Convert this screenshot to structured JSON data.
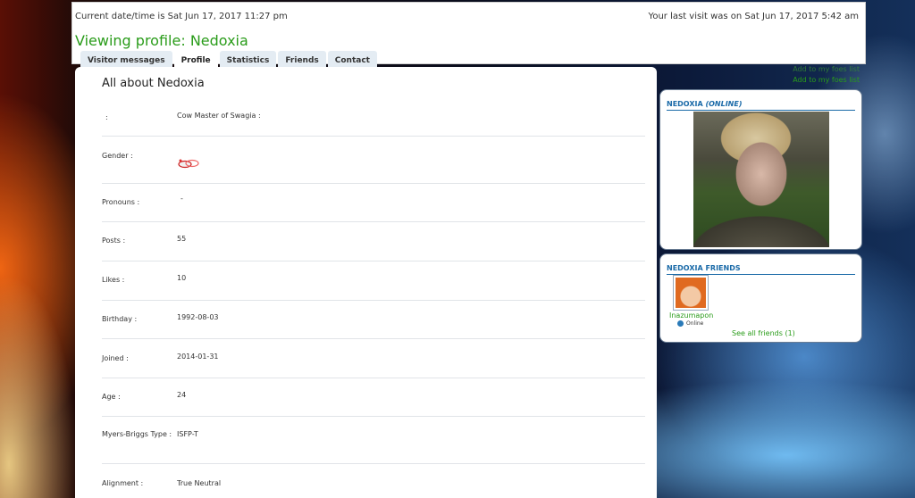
{
  "header": {
    "datetime": "Current date/time is Sat Jun 17, 2017 11:27 pm",
    "last_visit": "Your last visit was on Sat Jun 17, 2017 5:42 am",
    "title": "Viewing profile: Nedoxia"
  },
  "tabs": [
    {
      "label": "Visitor messages",
      "active": false
    },
    {
      "label": "Profile",
      "active": true
    },
    {
      "label": "Statistics",
      "active": false
    },
    {
      "label": "Friends",
      "active": false
    },
    {
      "label": "Contact",
      "active": false
    }
  ],
  "quick_links": [
    "Add to my foes list",
    "Add to my foes list"
  ],
  "profile": {
    "section_title": "All about Nedoxia",
    "fields": [
      {
        "label": ":",
        "value": "Cow Master of Swagia :"
      },
      {
        "label": "Gender :",
        "value": "",
        "icon": "gender-icon"
      },
      {
        "label": "Pronouns :",
        "value": "-"
      },
      {
        "label": "Posts :",
        "value": "55"
      },
      {
        "label": "Likes :",
        "value": "10"
      },
      {
        "label": "Birthday :",
        "value": "1992-08-03"
      },
      {
        "label": "Joined :",
        "value": "2014-01-31"
      },
      {
        "label": "Age :",
        "value": "24"
      },
      {
        "label": "Myers-Briggs Type :",
        "value": "ISFP-T"
      },
      {
        "label": "Alignment :",
        "value": "True Neutral"
      }
    ]
  },
  "user_panel": {
    "name": "NEDOXIA",
    "status": "(ONLINE)"
  },
  "friends_panel": {
    "title": "NEDOXIA FRIENDS",
    "friend_name": "Inazumapon",
    "friend_status": "Online",
    "see_all": "See all friends (1)"
  },
  "colors": {
    "accent_green": "#2a9c1a",
    "panel_blue": "#1a6aa8"
  }
}
